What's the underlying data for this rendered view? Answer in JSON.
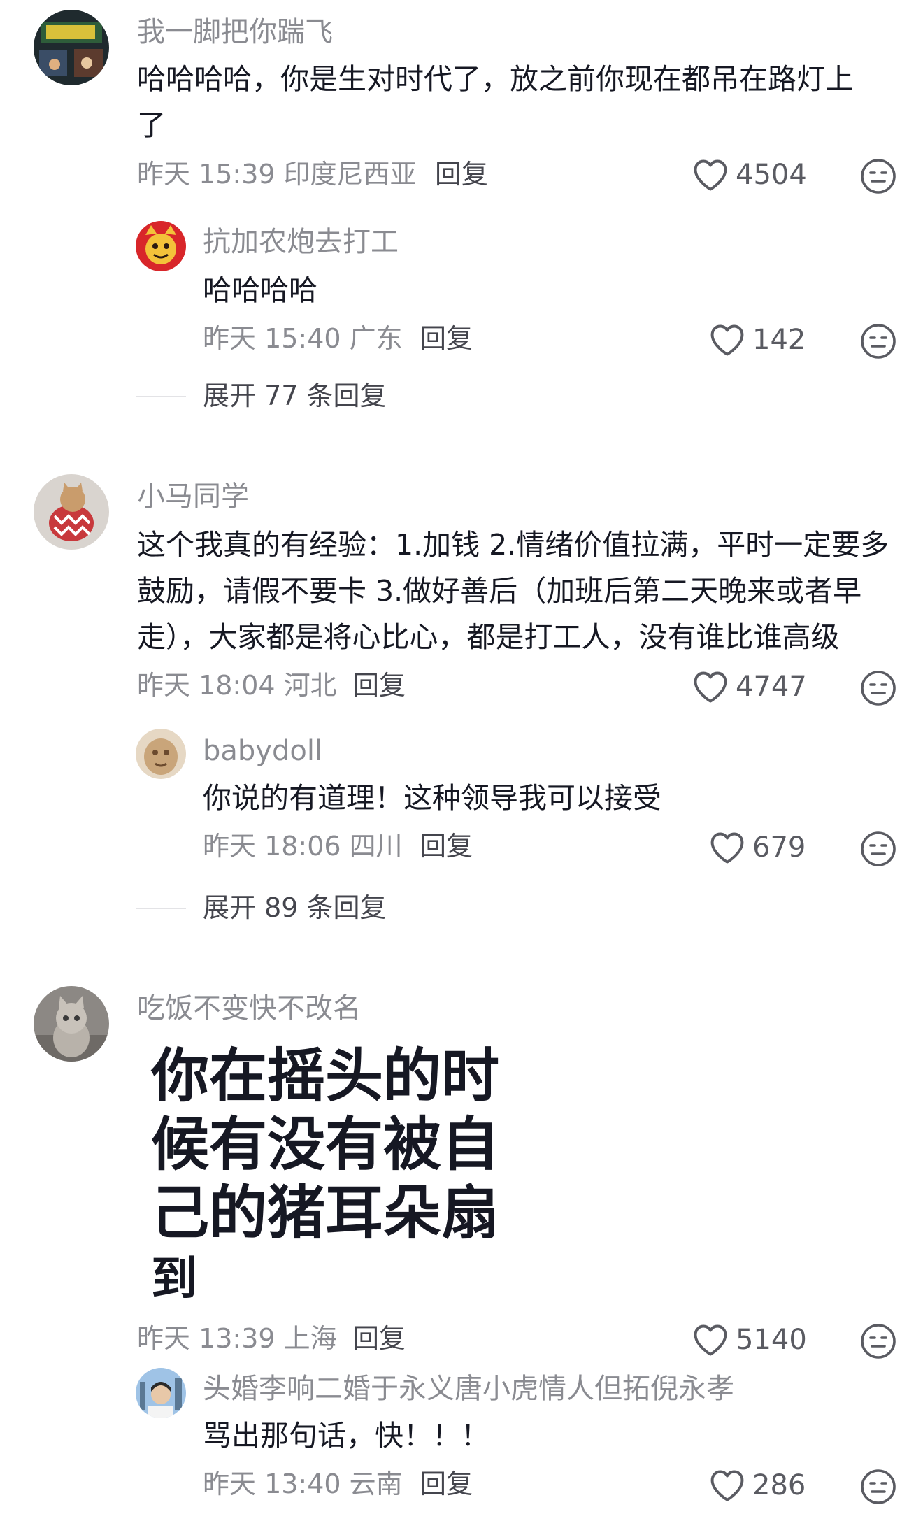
{
  "comments": [
    {
      "username": "我一脚把你踹飞",
      "lines": [
        "哈哈哈哈，你是生对时代了，放之前你现在都吊在路灯上",
        "了"
      ],
      "meta": "昨天 15:39 印度尼西亚",
      "reply_label": "回复",
      "likes": "4504",
      "replies": [
        {
          "username": "抗加农炮去打工",
          "text": "哈哈哈哈",
          "meta": "昨天 15:40 广东",
          "reply_label": "回复",
          "likes": "142"
        }
      ],
      "expand_label": "展开 77 条回复"
    },
    {
      "username": "小马同学",
      "lines": [
        "这个我真的有经验：1.加钱 2.情绪价值拉满，平时一定要多",
        "鼓励，请假不要卡 3.做好善后（加班后第二天晚来或者早",
        "走），大家都是将心比心，都是打工人，没有谁比谁高级"
      ],
      "meta": "昨天 18:04 河北",
      "reply_label": "回复",
      "likes": "4747",
      "replies": [
        {
          "username": "babydoll",
          "text": "你说的有道理！这种领导我可以接受",
          "meta": "昨天 18:06 四川",
          "reply_label": "回复",
          "likes": "679"
        }
      ],
      "expand_label": "展开 89 条回复"
    },
    {
      "username": "吃饭不变快不改名",
      "image_lines": [
        "你在摇头的时",
        "候有没有被自",
        "己的猪耳朵扇",
        "到"
      ],
      "meta": "昨天 13:39 上海",
      "reply_label": "回复",
      "likes": "5140",
      "replies": [
        {
          "username": "头婚李响二婚于永义唐小虎情人但拓倪永孝",
          "text": "骂出那句话，快！！！",
          "meta": "昨天 13:40 云南",
          "reply_label": "回复",
          "likes": "286"
        }
      ]
    }
  ],
  "icons": {
    "like": "heart-outline-icon",
    "dislike": "meh-face-icon"
  },
  "colors": {
    "text": "#161823",
    "secondary": "#8a8b91",
    "icon": "#5a5b62"
  }
}
